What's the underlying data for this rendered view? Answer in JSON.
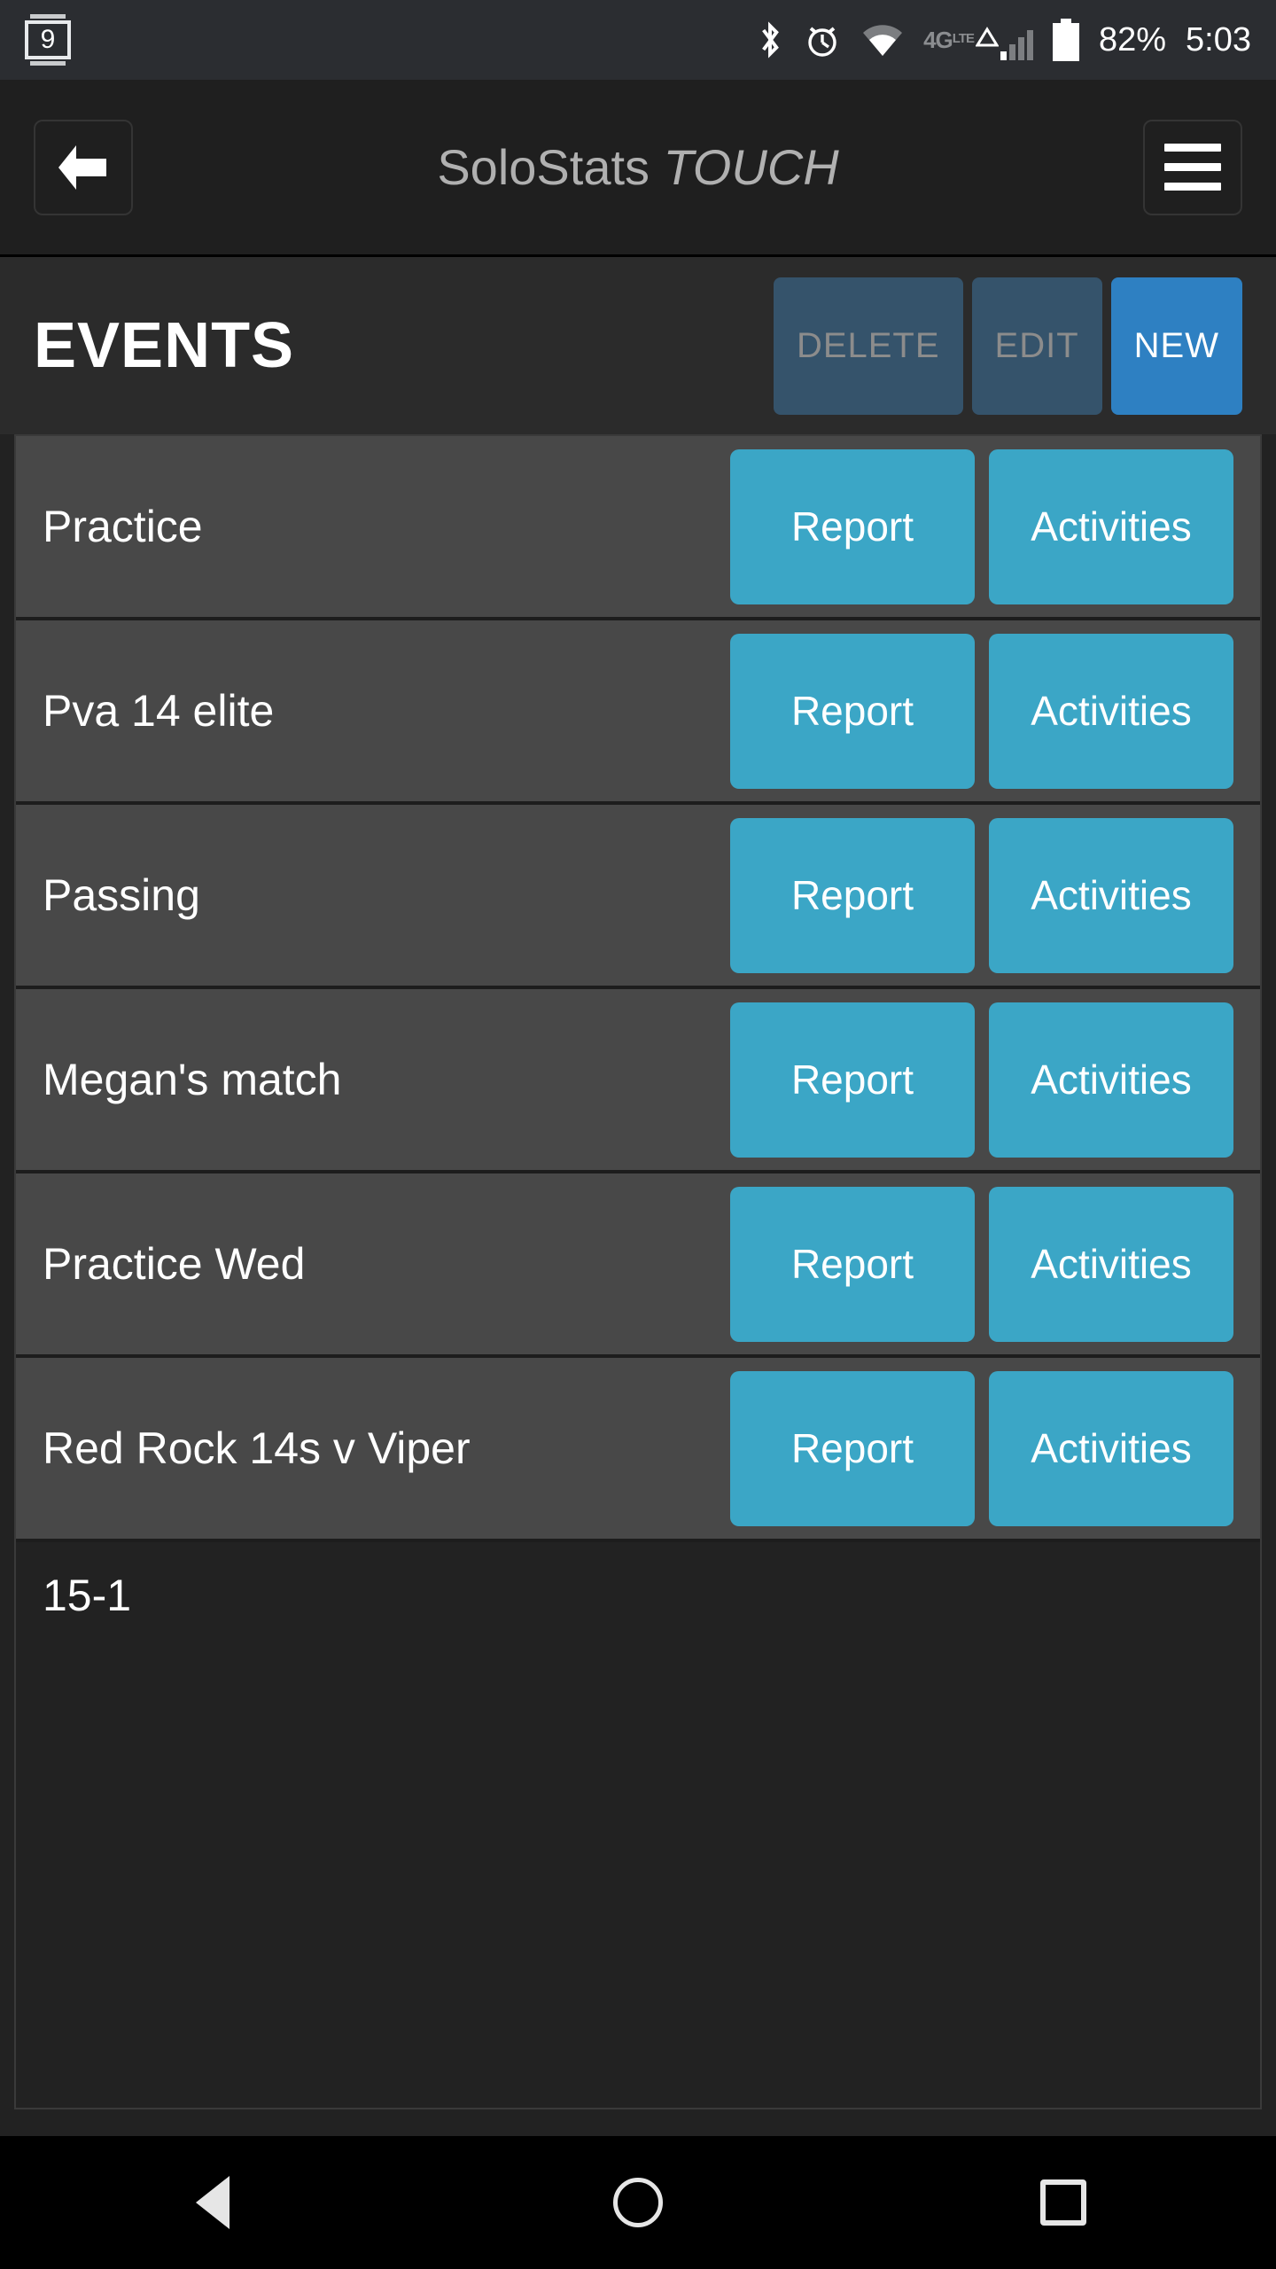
{
  "status_bar": {
    "notification_badge": "9",
    "icons": [
      "notification-badge-icon",
      "bluetooth-icon",
      "alarm-icon",
      "wifi-icon",
      "lte-4g-icon",
      "signal-bars-icon",
      "battery-icon"
    ],
    "network_label": "4G",
    "network_sup": "LTE",
    "battery_percent": "82%",
    "clock": "5:03",
    "background": "#2b2d31"
  },
  "app_bar": {
    "back_icon": "back-arrow-icon",
    "title_main": "SoloStats ",
    "title_italic": "TOUCH",
    "menu_icon": "hamburger-menu-icon",
    "background": "#1f1f1f",
    "title_color": "#b0b0b0"
  },
  "events_header": {
    "title": "EVENTS",
    "actions": [
      {
        "label": "DELETE",
        "state": "disabled",
        "name": "delete-button"
      },
      {
        "label": "EDIT",
        "state": "disabled",
        "name": "edit-button"
      },
      {
        "label": "NEW",
        "state": "enabled",
        "name": "new-button"
      }
    ],
    "disabled_bg": "#35536b",
    "disabled_fg": "#8c8c8c",
    "primary_bg": "#2e80c2",
    "primary_fg": "#ffffff"
  },
  "event_list": {
    "row_bg": "#484848",
    "row_button_bg": "#3ba6c6",
    "buttons": {
      "report": "Report",
      "activities": "Activities"
    },
    "rows": [
      {
        "name": "Practice"
      },
      {
        "name": "Pva 14 elite"
      },
      {
        "name": "Passing"
      },
      {
        "name": "Megan's match"
      },
      {
        "name": "Practice Wed"
      },
      {
        "name": "Red Rock 14s v Viper"
      }
    ],
    "trailing_text": "15-1"
  },
  "nav_bar": {
    "background": "#000000",
    "keys": [
      {
        "name": "nav-back-icon"
      },
      {
        "name": "nav-home-icon"
      },
      {
        "name": "nav-recents-icon"
      }
    ]
  }
}
